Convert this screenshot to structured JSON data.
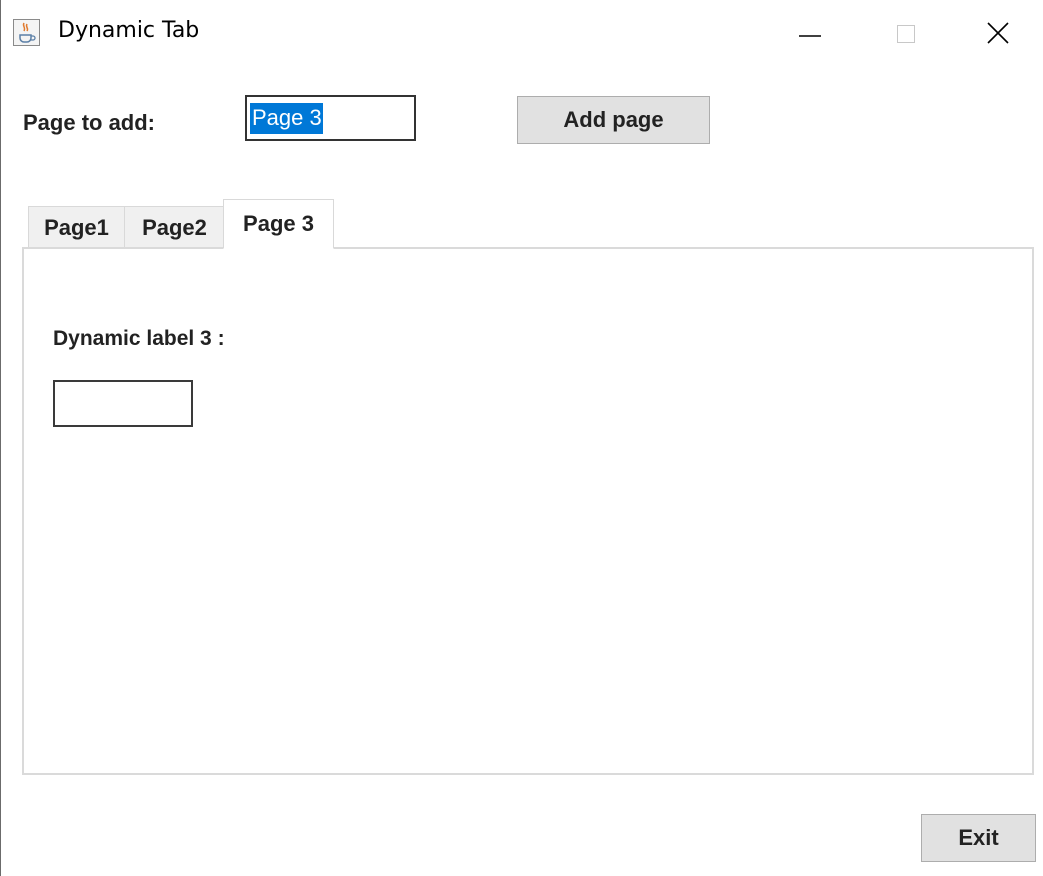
{
  "window": {
    "title": "Dynamic Tab",
    "icon": "java-cup-icon"
  },
  "form": {
    "page_label": "Page to add:",
    "page_input_value": "Page 3",
    "add_button_label": "Add page"
  },
  "tabs": [
    {
      "label": "Page1",
      "active": false
    },
    {
      "label": "Page2",
      "active": false
    },
    {
      "label": "Page 3",
      "active": true
    }
  ],
  "panel": {
    "dynamic_label": "Dynamic label 3 :",
    "dynamic_input_value": ""
  },
  "footer": {
    "exit_label": "Exit"
  },
  "colors": {
    "selection": "#0078d7",
    "button_bg": "#e1e1e1",
    "tab_inactive_bg": "#f0f0f0"
  }
}
